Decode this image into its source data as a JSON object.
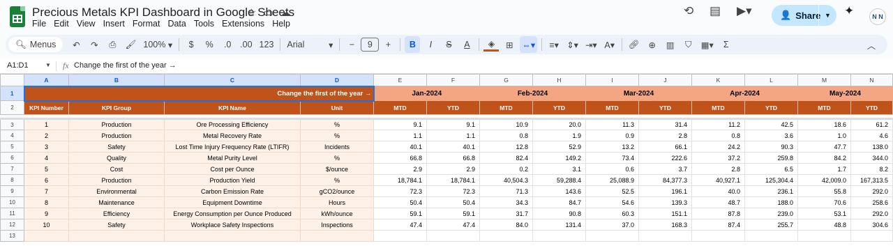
{
  "app": {
    "doc_title": "Precious Metals KPI Dashboard in Google Sheets",
    "menus": [
      "File",
      "Edit",
      "View",
      "Insert",
      "Format",
      "Data",
      "Tools",
      "Extensions",
      "Help"
    ],
    "share_label": "Share",
    "avatar_text": "N N"
  },
  "toolbar": {
    "menus_label": "Menus",
    "zoom": "100%",
    "currency": "$",
    "percent": "%",
    "dec_decrease": ".0",
    "dec_increase": ".00",
    "number_format": "123",
    "font": "Arial",
    "font_size": "9",
    "bold": "B",
    "italic": "I",
    "strike": "S",
    "text_color": "A"
  },
  "formula_bar": {
    "name_box": "A1:D1",
    "fx": "fx",
    "content": "Change the first of the year →"
  },
  "grid": {
    "columns": [
      "A",
      "B",
      "C",
      "D",
      "E",
      "F",
      "G",
      "H",
      "I",
      "J",
      "K",
      "L",
      "M",
      "N"
    ],
    "row_numbers": [
      "1",
      "2",
      "3",
      "4",
      "5",
      "6",
      "7",
      "8",
      "9",
      "10",
      "11",
      "12",
      "13"
    ],
    "banner": "Change the first of the year →",
    "months": [
      "Jan-2024",
      "Feb-2024",
      "Mar-2024",
      "Apr-2024",
      "May-2024"
    ],
    "headers": [
      "KPI Number",
      "KPI Group",
      "KPI Name",
      "Unit"
    ],
    "mtd": "MTD",
    "ytd": "YTD",
    "rows": [
      {
        "num": "1",
        "group": "Production",
        "name": "Ore Processing Efficiency",
        "unit": "%",
        "vals": [
          "9.1",
          "9.1",
          "10.9",
          "20.0",
          "11.3",
          "31.4",
          "11.2",
          "42.5",
          "18.6",
          "61.2"
        ]
      },
      {
        "num": "2",
        "group": "Production",
        "name": "Metal Recovery Rate",
        "unit": "%",
        "vals": [
          "1.1",
          "1.1",
          "0.8",
          "1.9",
          "0.9",
          "2.8",
          "0.8",
          "3.6",
          "1.0",
          "4.6"
        ]
      },
      {
        "num": "3",
        "group": "Safety",
        "name": "Lost Time Injury Frequency Rate (LTIFR)",
        "unit": "Incidents",
        "vals": [
          "40.1",
          "40.1",
          "12.8",
          "52.9",
          "13.2",
          "66.1",
          "24.2",
          "90.3",
          "47.7",
          "138.0"
        ]
      },
      {
        "num": "4",
        "group": "Quality",
        "name": "Metal Purity Level",
        "unit": "%",
        "vals": [
          "66.8",
          "66.8",
          "82.4",
          "149.2",
          "73.4",
          "222.6",
          "37.2",
          "259.8",
          "84.2",
          "344.0"
        ]
      },
      {
        "num": "5",
        "group": "Cost",
        "name": "Cost per Ounce",
        "unit": "$/ounce",
        "vals": [
          "2.9",
          "2.9",
          "0.2",
          "3.1",
          "0.6",
          "3.7",
          "2.8",
          "6.5",
          "1.7",
          "8.2"
        ]
      },
      {
        "num": "6",
        "group": "Production",
        "name": "Production Yield",
        "unit": "%",
        "vals": [
          "18,784.1",
          "18,784.1",
          "40,504.3",
          "59,288.4",
          "25,088.9",
          "84,377.3",
          "40,927.1",
          "125,304.4",
          "42,009.0",
          "167,313.5"
        ]
      },
      {
        "num": "7",
        "group": "Environmental",
        "name": "Carbon Emission Rate",
        "unit": "gCO2/ounce",
        "vals": [
          "72.3",
          "72.3",
          "71.3",
          "143.6",
          "52.5",
          "196.1",
          "40.0",
          "236.1",
          "55.8",
          "292.0"
        ]
      },
      {
        "num": "8",
        "group": "Maintenance",
        "name": "Equipment Downtime",
        "unit": "Hours",
        "vals": [
          "50.4",
          "50.4",
          "34.3",
          "84.7",
          "54.6",
          "139.3",
          "48.7",
          "188.0",
          "70.6",
          "258.6"
        ]
      },
      {
        "num": "9",
        "group": "Efficiency",
        "name": "Energy Consumption per Ounce Produced",
        "unit": "kWh/ounce",
        "vals": [
          "59.1",
          "59.1",
          "31.7",
          "90.8",
          "60.3",
          "151.1",
          "87.8",
          "239.0",
          "53.1",
          "292.0"
        ]
      },
      {
        "num": "10",
        "group": "Safety",
        "name": "Workplace Safety Inspections",
        "unit": "Inspections",
        "vals": [
          "47.4",
          "47.4",
          "84.0",
          "131.4",
          "37.0",
          "168.3",
          "87.4",
          "255.7",
          "48.8",
          "304.6"
        ]
      }
    ]
  },
  "colors": {
    "banner": "#c0531a",
    "month": "#f4a582",
    "selection": "#1a73e8"
  }
}
